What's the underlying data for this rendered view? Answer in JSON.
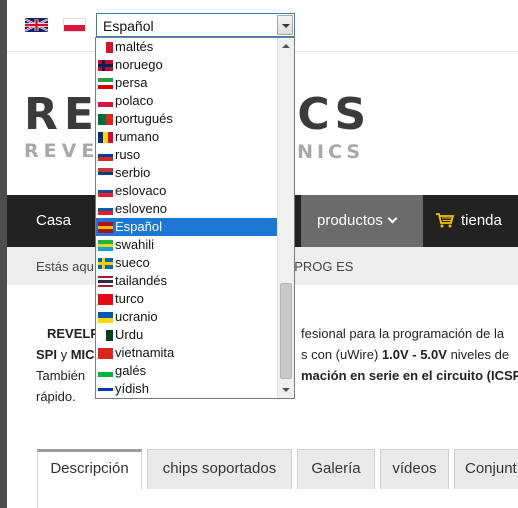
{
  "language_selector": {
    "selected": "Español",
    "options": [
      {
        "label": "maltés",
        "flag": [
          "#ffffff",
          "#cf142b"
        ],
        "flag_dir": "v"
      },
      {
        "label": "noruego",
        "flag": [
          "#ba0c2f",
          "#00205b"
        ],
        "flag_dir": "cross"
      },
      {
        "label": "persa",
        "flag": [
          "#239f40",
          "#ffffff",
          "#da0000"
        ],
        "flag_dir": "h"
      },
      {
        "label": "polaco",
        "flag": [
          "#ffffff",
          "#dc143c"
        ],
        "flag_dir": "h"
      },
      {
        "label": "portugués",
        "flag": [
          "#046a38",
          "#da291c"
        ],
        "flag_dir": "v"
      },
      {
        "label": "rumano",
        "flag": [
          "#002b7f",
          "#fcd116",
          "#ce1126"
        ],
        "flag_dir": "v"
      },
      {
        "label": "ruso",
        "flag": [
          "#ffffff",
          "#0039a6",
          "#d52b1e"
        ],
        "flag_dir": "h"
      },
      {
        "label": "serbio",
        "flag": [
          "#c6363c",
          "#0c4076",
          "#ffffff"
        ],
        "flag_dir": "h"
      },
      {
        "label": "eslovaco",
        "flag": [
          "#ffffff",
          "#0b4ea2",
          "#ee1c25"
        ],
        "flag_dir": "h"
      },
      {
        "label": "esloveno",
        "flag": [
          "#ffffff",
          "#005da4",
          "#ed1c24"
        ],
        "flag_dir": "h"
      },
      {
        "label": "Español",
        "flag": [
          "#aa151b",
          "#f1bf00",
          "#aa151b"
        ],
        "flag_dir": "h"
      },
      {
        "label": "swahili",
        "flag": [
          "#1eb53a",
          "#fcd116",
          "#00a3dd"
        ],
        "flag_dir": "h"
      },
      {
        "label": "sueco",
        "flag": [
          "#006aa7",
          "#fecc00"
        ],
        "flag_dir": "cross"
      },
      {
        "label": "tailandés",
        "flag": [
          "#a51931",
          "#f4f5f8",
          "#2d2a4a",
          "#f4f5f8",
          "#a51931"
        ],
        "flag_dir": "h"
      },
      {
        "label": "turco",
        "flag": [
          "#e30a17"
        ],
        "flag_dir": "h"
      },
      {
        "label": "ucranio",
        "flag": [
          "#0057b7",
          "#ffd700"
        ],
        "flag_dir": "h"
      },
      {
        "label": "Urdu",
        "flag": [
          "#ffffff",
          "#01411c"
        ],
        "flag_dir": "v"
      },
      {
        "label": "vietnamita",
        "flag": [
          "#da251d"
        ],
        "flag_dir": "h"
      },
      {
        "label": "galés",
        "flag": [
          "#ffffff",
          "#00b140"
        ],
        "flag_dir": "h"
      },
      {
        "label": "yídish",
        "flag": [
          "#ffffff",
          "#0038b8",
          "#ffffff"
        ],
        "flag_dir": "h"
      }
    ]
  },
  "logo": {
    "top_left": "REVEL",
    "top_right": "ICS",
    "bottom_left": "REVELP",
    "bottom_right": "ONICS"
  },
  "nav": {
    "home": "Casa",
    "products": "productos",
    "shop": "tienda"
  },
  "breadcrumb": {
    "prefix": "Estás aquí",
    "current": "LPROG ES"
  },
  "content": {
    "line1_bold": "REVELP",
    "line1_rest": "fesional para la programación de la",
    "line2_bold_a": "SPI",
    "line2_mid": " y ",
    "line2_bold_b": "MIC",
    "line2_rest_a": "s con (uWire) ",
    "line2_bold_c": "1.0V - 5.0V",
    "line2_rest_b": " niveles de",
    "line3_a": "También",
    "line3_bold": "mación en serie en el circuito (ICSP",
    "line4": "rápido."
  },
  "tabs": [
    "Descripción",
    "chips soportados",
    "Galería",
    "vídeos",
    "Conjunt"
  ],
  "colors": {
    "nav_bg": "#222222",
    "nav_active": "#6b6b6b",
    "selection": "#1e77d3"
  }
}
